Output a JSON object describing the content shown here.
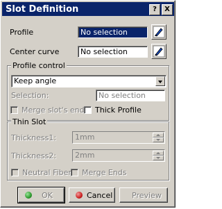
{
  "window": {
    "title": "Slot Definition",
    "help_btn": "?",
    "close_btn": "X"
  },
  "profile": {
    "label": "Profile",
    "value": "No selection"
  },
  "center_curve": {
    "label": "Center curve",
    "value": "No selection"
  },
  "profile_control": {
    "group_title": "Profile control",
    "selected_option": "Keep angle",
    "selection_label": "Selection:",
    "selection_value": "No selection"
  },
  "checkboxes": {
    "merge_slots_ends": "Merge slot's ends",
    "thick_profile": "Thick Profile"
  },
  "thin_slot": {
    "group_title": "Thin Slot",
    "thickness1_label": "Thickness1:",
    "thickness1_value": "1mm",
    "thickness2_label": "Thickness2:",
    "thickness2_value": "2mm",
    "neutral_fiber": "Neutral Fiber",
    "merge_ends": "Merge Ends"
  },
  "buttons": {
    "ok": "OK",
    "cancel": "Cancel",
    "preview": "Preview"
  },
  "colors": {
    "titlebar": "#0a246a",
    "ok_dot": "#2e9a2e",
    "cancel_dot": "#cc2222"
  }
}
